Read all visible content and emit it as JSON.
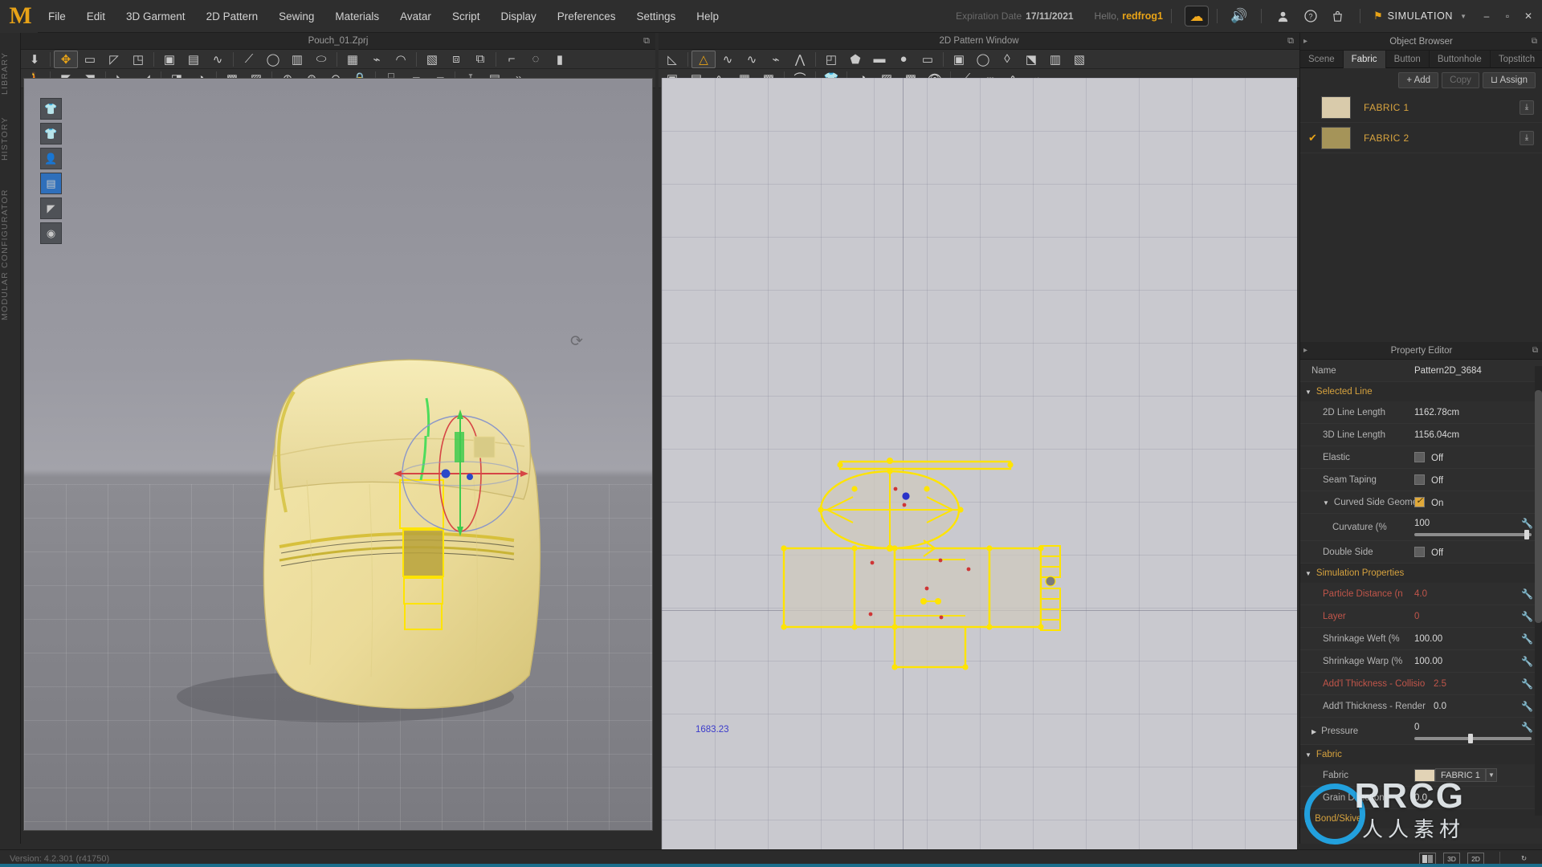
{
  "app": {
    "logo": "M",
    "version_status": "Version: 4.2.301 (r41750)"
  },
  "menu": {
    "items": [
      "File",
      "Edit",
      "3D Garment",
      "2D Pattern",
      "Sewing",
      "Materials",
      "Avatar",
      "Script",
      "Display",
      "Preferences",
      "Settings",
      "Help"
    ],
    "expiration_label": "Expiration Date",
    "expiration_date": "17/11/2021",
    "hello_label": "Hello,",
    "username": "redfrog1",
    "cloud_icon": "cloud-icon",
    "sound_icon": "speaker-icon",
    "account_icon": "user-icon",
    "help_icon": "question-mark-icon",
    "cart_icon": "shopping-bag-icon",
    "mode_icon": "flag-icon",
    "mode_label": "SIMULATION",
    "mode_caret": "▼",
    "window_minimize": "–",
    "window_maximize": "▫",
    "window_close": "✕"
  },
  "left_rail": {
    "labels": [
      "LIBRARY",
      "HISTORY",
      "MODULAR CONFIGURATOR"
    ]
  },
  "window_3d": {
    "title": "Pouch_01.Zprj",
    "popout_icon": "popout-icon",
    "toolbar_row1": [
      {
        "name": "gravity-tool",
        "glyph": "⬇",
        "sel": false
      },
      {
        "name": "transform-tool",
        "glyph": "✥",
        "sel": true,
        "accent": true
      },
      {
        "name": "rect-select-tool",
        "glyph": "▭",
        "sel": false
      },
      {
        "name": "box-select-tool",
        "glyph": "◸",
        "sel": false
      },
      {
        "name": "pattern-fold-tool",
        "glyph": "◳",
        "sel": false
      },
      {
        "name": "pin-tool",
        "glyph": "▣",
        "sel": false
      },
      {
        "name": "seamline-tool",
        "glyph": "▤",
        "sel": false
      },
      {
        "name": "curve-seam-tool",
        "glyph": "∿",
        "sel": false
      },
      {
        "name": "tack-tool",
        "glyph": "⟋",
        "sel": false
      },
      {
        "name": "tape-tool",
        "glyph": "◯",
        "sel": false
      },
      {
        "name": "garment-pin-tool",
        "glyph": "▥",
        "sel": false
      },
      {
        "name": "cylinder-pin-tool",
        "glyph": "⬭",
        "sel": false
      },
      {
        "name": "folding-arrangement",
        "glyph": "▦",
        "sel": false
      },
      {
        "name": "edit-pin-tool",
        "glyph": "⌁",
        "sel": false
      },
      {
        "name": "free-sew-tool",
        "glyph": "◠",
        "sel": false
      },
      {
        "name": "garment-fit-tool",
        "glyph": "▧",
        "sel": false
      },
      {
        "name": "symmetric-pattern",
        "glyph": "⧈",
        "sel": false
      },
      {
        "name": "arrange-tool",
        "glyph": "⧉",
        "sel": false
      },
      {
        "name": "measure-tool",
        "glyph": "⌐",
        "sel": false
      },
      {
        "name": "circumference-tool",
        "glyph": "◌",
        "sel": false
      },
      {
        "name": "ruler-tool",
        "glyph": "▮",
        "sel": false
      }
    ],
    "toolbar_row2": [
      {
        "name": "avatar-walk-tool",
        "glyph": "🚶"
      },
      {
        "name": "garment-select-tool",
        "glyph": "◤"
      },
      {
        "name": "garment-edit-tool",
        "glyph": "◥"
      },
      {
        "name": "trim-tool",
        "glyph": "◣"
      },
      {
        "name": "zipper-tool",
        "glyph": "◢"
      },
      {
        "name": "fold-tool",
        "glyph": "◨"
      },
      {
        "name": "roll-tool",
        "glyph": "◑"
      },
      {
        "name": "print-layout-tool",
        "glyph": "▩"
      },
      {
        "name": "texture-tool",
        "glyph": "▨"
      },
      {
        "name": "button-tool",
        "glyph": "⊕"
      },
      {
        "name": "buttonhole-tool",
        "glyph": "⊛"
      },
      {
        "name": "snap-tool",
        "glyph": "⊖"
      },
      {
        "name": "lock-button-tool",
        "glyph": "🔒"
      },
      {
        "name": "zipper-edit-tool",
        "glyph": "⌸"
      },
      {
        "name": "plane-tool",
        "glyph": "▰"
      },
      {
        "name": "surface-tool",
        "glyph": "▱"
      },
      {
        "name": "pleat-tool",
        "glyph": "⊺"
      },
      {
        "name": "shirring-tool",
        "glyph": "▤"
      },
      {
        "name": "more-tools",
        "glyph": "»"
      }
    ],
    "gizmo_buttons": [
      {
        "name": "show-garment-toggle",
        "glyph": "👕",
        "active": false
      },
      {
        "name": "show-garment-alt-toggle",
        "glyph": "👕",
        "active": false
      },
      {
        "name": "show-avatar-toggle",
        "glyph": "👤",
        "active": false
      },
      {
        "name": "show-pattern-toggle",
        "glyph": "▤",
        "active": true
      },
      {
        "name": "show-shading-toggle",
        "glyph": "◤",
        "active": false
      },
      {
        "name": "show-skin-toggle",
        "glyph": "◉",
        "active": false
      }
    ],
    "rotate_icon": "rotate-view-icon"
  },
  "window_2d": {
    "title": "2D Pattern Window",
    "popout_icon": "popout-icon",
    "toolbar_row1": [
      {
        "name": "edit-pattern-tool",
        "glyph": "◺",
        "sel": false
      },
      {
        "name": "edit-curve-point-tool",
        "glyph": "△",
        "sel": true,
        "accent": true
      },
      {
        "name": "edit-curvature-tool",
        "glyph": "∿",
        "sel": false
      },
      {
        "name": "add-point-tool",
        "glyph": "∿",
        "sel": false
      },
      {
        "name": "split-line-tool",
        "glyph": "⌁",
        "sel": false
      },
      {
        "name": "segment-tool",
        "glyph": "⋀",
        "sel": false
      },
      {
        "name": "fold-pattern-tool",
        "glyph": "◰",
        "sel": false
      },
      {
        "name": "polygon-tool",
        "glyph": "⬟",
        "sel": false
      },
      {
        "name": "rectangle-tool",
        "glyph": "▬",
        "sel": false
      },
      {
        "name": "circle-tool",
        "glyph": "●",
        "sel": false
      },
      {
        "name": "inner-polygon-tool",
        "glyph": "▭",
        "sel": false
      },
      {
        "name": "inner-rect-tool",
        "glyph": "▣",
        "sel": false
      },
      {
        "name": "inner-circle-tool",
        "glyph": "◯",
        "sel": false
      },
      {
        "name": "dart-tool",
        "glyph": "◊",
        "sel": false
      },
      {
        "name": "notch-tool",
        "glyph": "⬔",
        "sel": false
      },
      {
        "name": "pleat-fold-tool",
        "glyph": "▥",
        "sel": false
      },
      {
        "name": "flip-tool",
        "glyph": "▧",
        "sel": false
      }
    ],
    "toolbar_row2": [
      {
        "name": "sew-tool",
        "glyph": "▣"
      },
      {
        "name": "segment-sew-tool",
        "glyph": "▤"
      },
      {
        "name": "free-sew-2d-tool",
        "glyph": "∿"
      },
      {
        "name": "check-sew-tool",
        "glyph": "▦"
      },
      {
        "name": "search-sew-tool",
        "glyph": "▩"
      },
      {
        "name": "iron-tool",
        "glyph": "⌒"
      },
      {
        "name": "garment-2d-tool",
        "glyph": "👕"
      },
      {
        "name": "roll-2d-tool",
        "glyph": "◑"
      },
      {
        "name": "texture-2d-tool",
        "glyph": "▨"
      },
      {
        "name": "pattern-texture-tool",
        "glyph": "▩"
      },
      {
        "name": "eye-tool",
        "glyph": "👁"
      },
      {
        "name": "baseline-tool",
        "glyph": "⟋"
      },
      {
        "name": "dashed-line-tool",
        "glyph": "┅"
      },
      {
        "name": "wave-line-tool",
        "glyph": "∿"
      },
      {
        "name": "trace-tool",
        "glyph": "⌁"
      }
    ],
    "measure_label": "1683.23"
  },
  "object_browser": {
    "title": "Object Browser",
    "popout_icon": "popout-icon",
    "collapse_icon": "collapse-icon",
    "tabs": [
      {
        "label": "Scene",
        "active": false
      },
      {
        "label": "Fabric",
        "active": true
      },
      {
        "label": "Button",
        "active": false
      },
      {
        "label": "Buttonhole",
        "active": false
      },
      {
        "label": "Topstitch",
        "active": false
      }
    ],
    "actions": [
      {
        "label": "+ Add",
        "name": "add-button",
        "dim": false
      },
      {
        "label": "Copy",
        "name": "copy-button",
        "dim": true
      },
      {
        "label": "⊔ Assign",
        "name": "assign-button",
        "dim": false
      }
    ],
    "fabrics": [
      {
        "name": "FABRIC 1",
        "checked": false,
        "color": "#d9cbab",
        "download_icon": "download-icon"
      },
      {
        "name": "FABRIC 2",
        "checked": true,
        "color": "#a59459",
        "download_icon": "download-icon"
      }
    ]
  },
  "property_editor": {
    "title": "Property Editor",
    "popout_icon": "popout-icon",
    "collapse_icon": "collapse-icon",
    "name_label": "Name",
    "name_value": "Pattern2D_3684",
    "sections": {
      "selected_line": {
        "label": "Selected Line",
        "arrow": "▼",
        "rows": [
          {
            "key": "2D Line Length",
            "value": "1162.78cm",
            "type": "text"
          },
          {
            "key": "3D Line Length",
            "value": "1156.04cm",
            "type": "text"
          },
          {
            "key": "Elastic",
            "value": "Off",
            "type": "check",
            "on": false
          },
          {
            "key": "Seam Taping",
            "value": "Off",
            "type": "check",
            "on": false
          },
          {
            "key": "Curved Side Geome",
            "value": "On",
            "type": "check",
            "on": true,
            "arrow": "▼"
          }
        ],
        "curvature": {
          "key": "Curvature (%",
          "value": "100",
          "slider_pct": 96,
          "wrench": "wrench-icon"
        },
        "double_side": {
          "key": "Double Side",
          "value": "Off",
          "on": false
        }
      },
      "simulation_properties": {
        "label": "Simulation Properties",
        "arrow": "▼",
        "rows": [
          {
            "key": "Particle Distance (n",
            "value": "4.0",
            "red": true,
            "wrench": "wrench-icon"
          },
          {
            "key": "Layer",
            "value": "0",
            "red": true,
            "wrench": "wrench-icon"
          },
          {
            "key": "Shrinkage Weft (%",
            "value": "100.00",
            "red": false,
            "wrench": "wrench-icon"
          },
          {
            "key": "Shrinkage Warp (%",
            "value": "100.00",
            "red": false,
            "wrench": "wrench-icon"
          },
          {
            "key": "Add'l Thickness - Collisio",
            "value": "2.5",
            "red": true,
            "wrench": "wrench-icon"
          },
          {
            "key": "Add'l Thickness - Render",
            "value": "0.0",
            "red": false,
            "wrench": "wrench-icon"
          }
        ],
        "pressure": {
          "key": "Pressure",
          "arrow": "▶",
          "value": "0",
          "slider_pct": 48,
          "wrench": "wrench-icon"
        }
      },
      "fabric": {
        "label": "Fabric",
        "arrow": "▼",
        "rows": [
          {
            "key": "Fabric",
            "value": "FABRIC 1",
            "type": "select",
            "swatch": "#e2d3b6",
            "caret": "▼"
          },
          {
            "key": "Grain Direction",
            "value": "0.0",
            "type": "text"
          }
        ]
      },
      "bond_skive": {
        "label": "Bond/Skive",
        "arrow": "▶"
      }
    }
  },
  "status_bar": {
    "version": "Version: 4.2.301 (r41750)",
    "buttons": [
      {
        "label": "",
        "name": "split-view-button"
      },
      {
        "label": "3D",
        "name": "view-3d-button"
      },
      {
        "label": "2D",
        "name": "view-2d-button"
      },
      {
        "label": "↻",
        "name": "reset-view-button"
      }
    ]
  },
  "watermark": {
    "text": "RRCG",
    "subtext": "人人素材"
  },
  "colors": {
    "accent": "#e8a317",
    "pattern_yellow": "#ffe400",
    "bag": "#efe0a0",
    "red_param": "#c0554a",
    "blue_label": "#3b3bcb"
  }
}
